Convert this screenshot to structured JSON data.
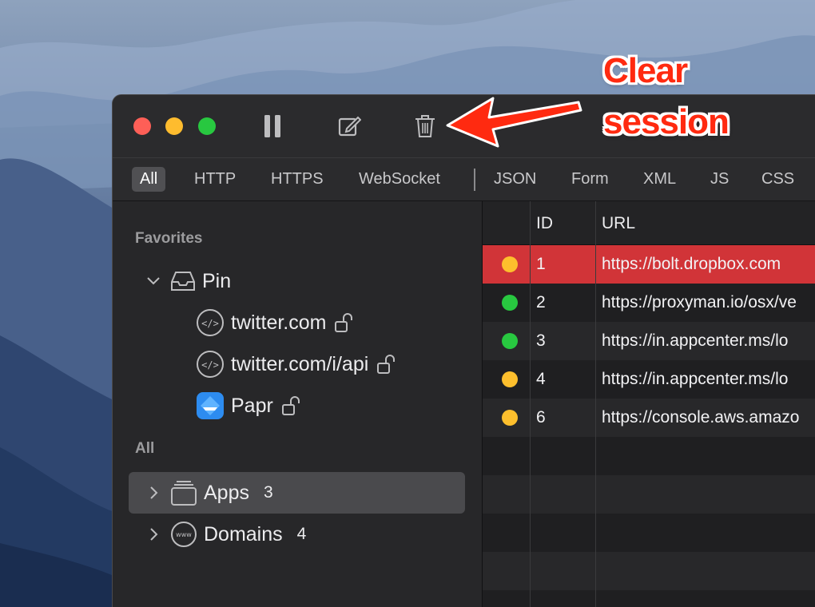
{
  "toolbar": {
    "pause_icon": "pause-icon",
    "compose_icon": "compose-icon",
    "trash_icon": "trash-icon"
  },
  "filters": {
    "items": [
      "All",
      "HTTP",
      "HTTPS",
      "WebSocket",
      "JSON",
      "Form",
      "XML",
      "JS",
      "CSS"
    ],
    "active": "All"
  },
  "sidebar": {
    "favorites_title": "Favorites",
    "pin_label": "Pin",
    "pinned": [
      {
        "label": "twitter.com",
        "icon": "code-icon"
      },
      {
        "label": "twitter.com/i/api",
        "icon": "code-icon"
      },
      {
        "label": "Papr",
        "icon": "app-icon"
      }
    ],
    "all_title": "All",
    "groups": [
      {
        "label": "Apps",
        "count": "3",
        "icon": "stack-icon"
      },
      {
        "label": "Domains",
        "count": "4",
        "icon": "www-icon"
      }
    ]
  },
  "table": {
    "headers": {
      "id": "ID",
      "url": "URL"
    },
    "rows": [
      {
        "id": "1",
        "url": "https://bolt.dropbox.com",
        "status_color": "#fdbf2d",
        "selected": true
      },
      {
        "id": "2",
        "url": "https://proxyman.io/osx/ve",
        "status_color": "#28c840",
        "selected": false
      },
      {
        "id": "3",
        "url": "https://in.appcenter.ms/lo",
        "status_color": "#28c840",
        "selected": false
      },
      {
        "id": "4",
        "url": "https://in.appcenter.ms/lo",
        "status_color": "#fdbf2d",
        "selected": false
      },
      {
        "id": "6",
        "url": "https://console.aws.amazo",
        "status_color": "#fdbf2d",
        "selected": false
      }
    ]
  },
  "annotation": {
    "line1": "Clear",
    "line2": "session",
    "color": "#ff2a10"
  }
}
